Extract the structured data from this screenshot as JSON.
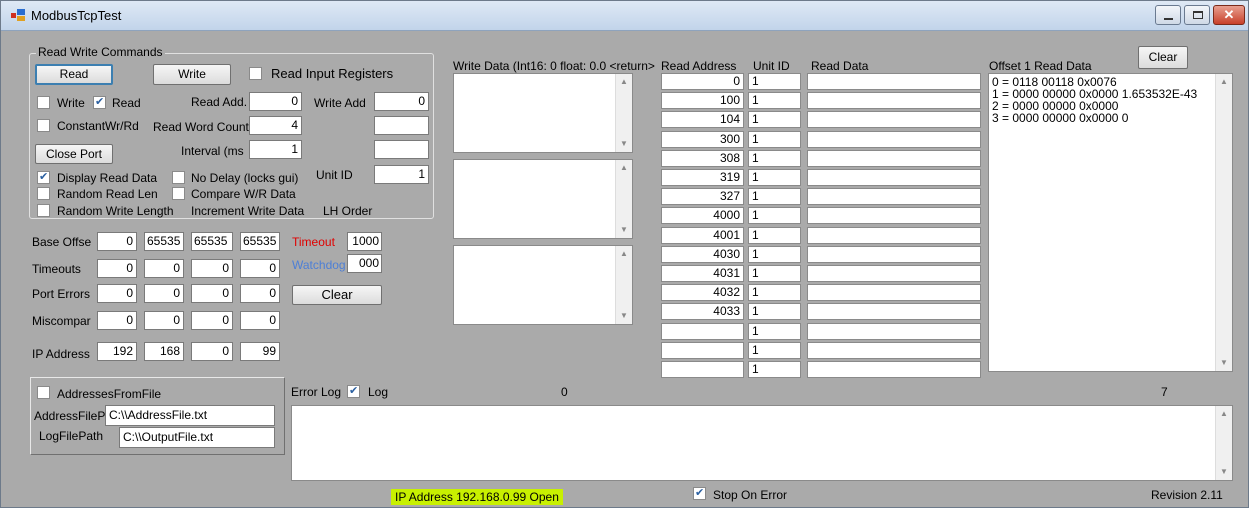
{
  "window": {
    "title": "ModbusTcpTest"
  },
  "group": {
    "title": "Read Write Commands"
  },
  "buttons": {
    "read": "Read",
    "write": "Write",
    "close_port": "Close Port",
    "clear_mid": "Clear",
    "clear_top": "Clear"
  },
  "checks": {
    "read_input_registers": "Read Input Registers",
    "write": "Write",
    "read": "Read",
    "constant_wr_rd": "ConstantWr/Rd",
    "display_read_data": "Display Read Data",
    "no_delay": "No Delay (locks gui)",
    "random_read_len": "Random Read Len",
    "compare_wr_data": "Compare W/R Data",
    "random_write_length": "Random Write Length",
    "increment_write_data": "Increment Write Data",
    "addresses_from_file": "AddressesFromFile",
    "log": "Log",
    "stop_on_error": "Stop On Error"
  },
  "labels": {
    "read_add": "Read Add.",
    "write_add": "Write Add",
    "read_word_count": "Read Word Count",
    "interval": "Interval (ms",
    "unit_id": "Unit ID",
    "lh_order": "LH Order",
    "base_offset": "Base Offse",
    "timeouts": "Timeouts",
    "port_errors": "Port Errors",
    "miscompare": "Miscompar",
    "ip_address": "IP Address",
    "timeout": "Timeout",
    "watchdog": "Watchdog",
    "address_file_path": "AddressFilePa",
    "log_file_path": "LogFilePath",
    "error_log": "Error Log",
    "write_data_header": "Write Data (Int16: 0 float: 0.0 <return>",
    "read_address_header": "Read Address",
    "unit_id_header": "Unit ID",
    "read_data_header": "Read Data",
    "offset_read_data_header": "Offset 1 Read Data",
    "error_count": "0",
    "read_count": "7",
    "revision": "Revision 2.11"
  },
  "values": {
    "read_add": "0",
    "write_add": "0",
    "read_word_count": "4",
    "interval": "1",
    "unit_id": "1",
    "base_offset": [
      "0",
      "65535",
      "65535",
      "65535"
    ],
    "timeouts": [
      "0",
      "0",
      "0",
      "0"
    ],
    "port_errors": [
      "0",
      "0",
      "0",
      "0"
    ],
    "miscompare": [
      "0",
      "0",
      "0",
      "0"
    ],
    "ip_address": [
      "192",
      "168",
      "0",
      "99"
    ],
    "timeout": "1000",
    "watchdog": "000",
    "address_file_path": "C:\\\\AddressFile.txt",
    "log_file_path": "C:\\\\OutputFile.txt"
  },
  "address_table": {
    "addresses": [
      "0",
      "100",
      "104",
      "300",
      "308",
      "319",
      "327",
      "4000",
      "4001",
      "4030",
      "4031",
      "4032",
      "4033",
      "",
      "",
      ""
    ],
    "unit_ids": [
      "1",
      "1",
      "1",
      "1",
      "1",
      "1",
      "1",
      "1",
      "1",
      "1",
      "1",
      "1",
      "1",
      "1",
      "1",
      "1"
    ]
  },
  "offset_read_data": [
    "0 = 0118 00118  0x0076",
    "1 = 0000 00000  0x0000  1.653532E-43",
    "2 = 0000 00000  0x0000",
    "3 = 0000 00000  0x0000  0"
  ],
  "status": {
    "connection": "IP Address 192.168.0.99 Open",
    "connection_bg": "#c8f000"
  },
  "colors": {
    "timeout_label": "#e00000",
    "watchdog_label": "#4d7fd6"
  }
}
